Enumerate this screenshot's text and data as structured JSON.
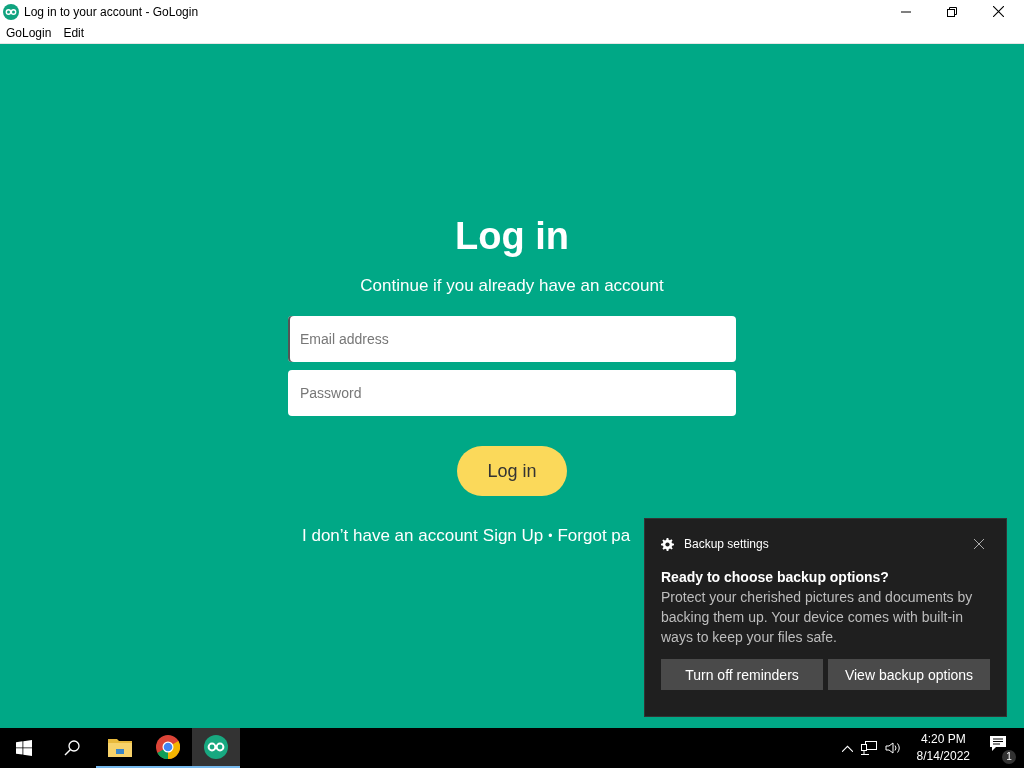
{
  "window": {
    "title": "Log in to your account - GoLogin"
  },
  "menu": [
    {
      "label": "GoLogin"
    },
    {
      "label": "Edit"
    }
  ],
  "login": {
    "heading": "Log in",
    "subtitle": "Continue if you already have an account",
    "email": {
      "placeholder": "Email address",
      "focused": true
    },
    "password": {
      "placeholder": "Password"
    },
    "submit": "Log in",
    "no_account": "I don’t have an account",
    "sign_up": "Sign Up",
    "separator": "•",
    "forgot": "Forgot pa"
  },
  "toast": {
    "app": "Backup settings",
    "heading": "Ready to choose backup options?",
    "body": "Protect your cherished pictures and documents by backing them up. Your device comes with built-in ways to keep your files safe.",
    "buttons": [
      "Turn off reminders",
      "View backup options"
    ]
  },
  "taskbar": {
    "apps": [
      {
        "kind": "explorer",
        "active": false
      },
      {
        "kind": "chrome",
        "active": false
      },
      {
        "kind": "gologin",
        "active": true
      }
    ],
    "time": "4:20 PM",
    "date": "8/14/2022",
    "notifications": "1"
  }
}
